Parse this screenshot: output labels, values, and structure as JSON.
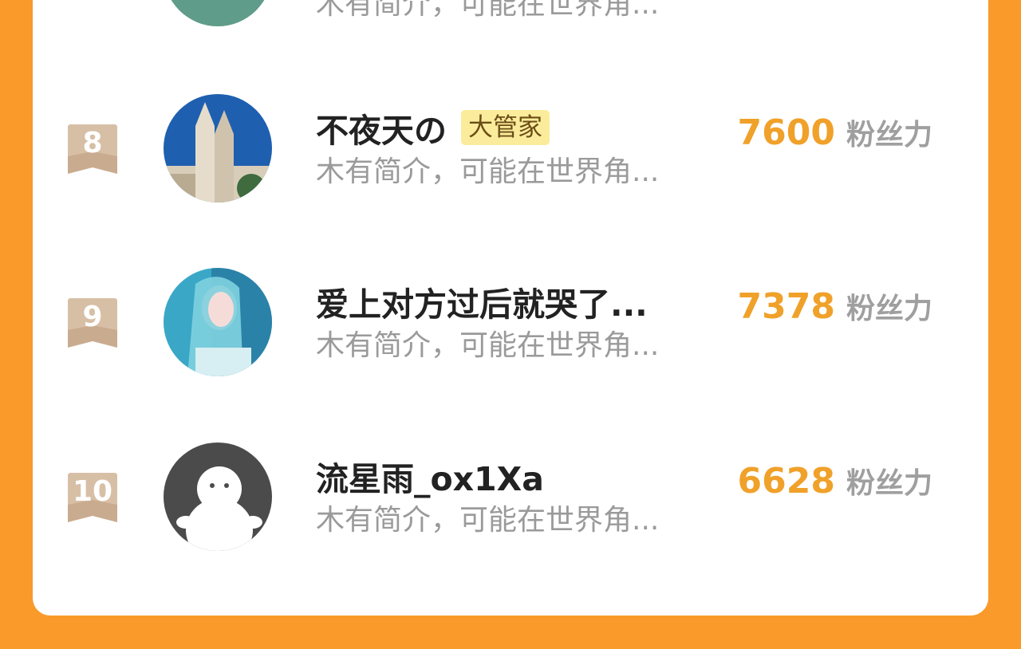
{
  "list": {
    "items": [
      {
        "rank": "",
        "name": "",
        "badge": "",
        "bio": "木有简介，可能在世界角...",
        "score": "",
        "unit": "",
        "avatar": "flower-photo"
      },
      {
        "rank": "8",
        "name": "不夜天の",
        "badge": "大管家",
        "bio": "木有简介，可能在世界角...",
        "score": "7600",
        "unit": "粉丝力",
        "avatar": "cathedral-photo"
      },
      {
        "rank": "9",
        "name": "爱上对方过后就哭了...",
        "badge": "",
        "bio": "木有简介，可能在世界角...",
        "score": "7378",
        "unit": "粉丝力",
        "avatar": "girl-photo"
      },
      {
        "rank": "10",
        "name": "流星雨_ox1Xa",
        "badge": "",
        "bio": "木有简介，可能在世界角...",
        "score": "6628",
        "unit": "粉丝力",
        "avatar": "default-avatar"
      }
    ]
  },
  "colors": {
    "background": "#f99a2a",
    "score": "#f0a12a",
    "rank_ribbon": "#c9ab8f",
    "badge": "#fbec9b"
  }
}
